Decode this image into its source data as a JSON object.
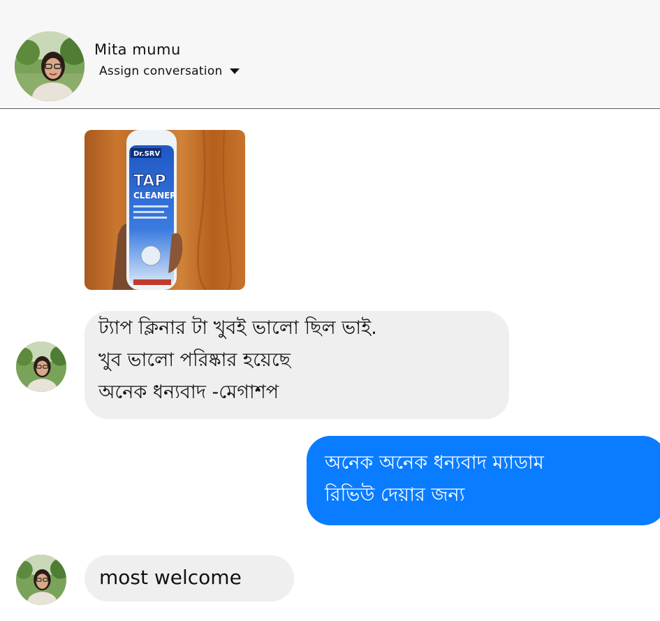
{
  "contact": {
    "name": "Mita mumu",
    "assign_label": "Assign conversation"
  },
  "messages": [
    {
      "direction": "incoming",
      "type": "image",
      "image_text": {
        "brand": "Dr.SRV",
        "product_line1": "TAP",
        "product_line2": "CLEANER"
      }
    },
    {
      "direction": "incoming",
      "type": "text",
      "lines": [
        "ট্যাপ ক্লিনার  টা খুবই ভালো ছিল ভাই.",
        "খুব ভালো পরিষ্কার হয়েছে",
        "অনেক ধন্যবাদ -মেগাশপ"
      ]
    },
    {
      "direction": "outgoing",
      "type": "text",
      "lines": [
        "অনেক অনেক ধন্যবাদ ম্যাডাম",
        "রিভিউ দেয়ার জন্য"
      ]
    },
    {
      "direction": "incoming",
      "type": "text",
      "lines": [
        "most welcome"
      ]
    }
  ],
  "colors": {
    "header_bg": "#f7f7f7",
    "incoming_bubble": "#efefef",
    "outgoing_bubble": "#0a7cff",
    "outgoing_text": "#ffffff"
  },
  "icons": {
    "assign_caret": "caret-down-icon"
  }
}
